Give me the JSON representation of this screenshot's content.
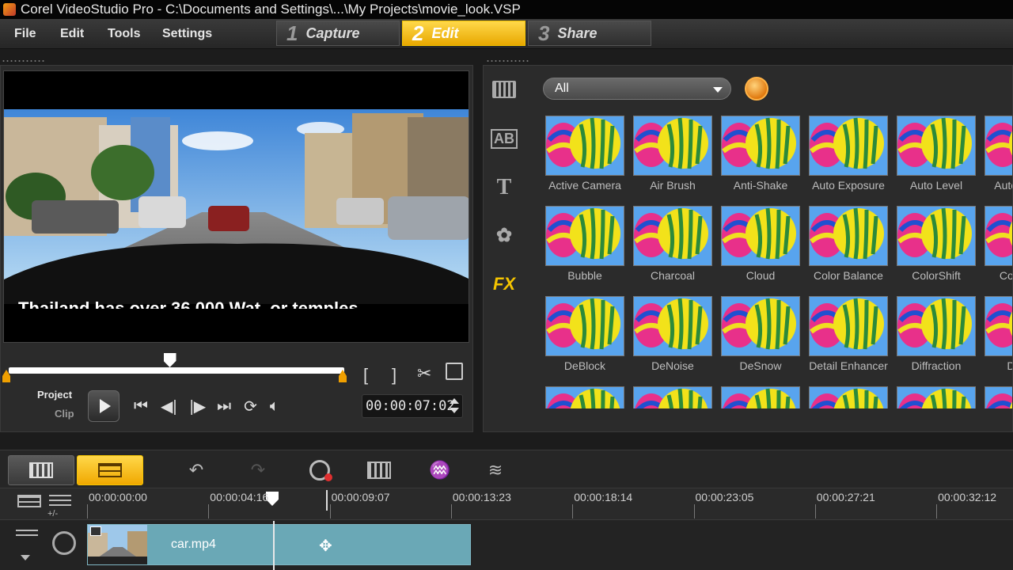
{
  "title": "Corel VideoStudio Pro - C:\\Documents and Settings\\...\\My Projects\\movie_look.VSP",
  "menu": {
    "file": "File",
    "edit": "Edit",
    "tools": "Tools",
    "settings": "Settings"
  },
  "steps": [
    {
      "num": "1",
      "label": "Capture"
    },
    {
      "num": "2",
      "label": "Edit"
    },
    {
      "num": "3",
      "label": "Share"
    }
  ],
  "preview": {
    "overlay_text": "Thailand has over 36,000 Wat, or temples",
    "project_label": "Project",
    "clip_label": "Clip",
    "timecode": "00:00:07:02",
    "scrub_position": 0.48
  },
  "library": {
    "filter": "All",
    "categories": [
      "media-icon",
      "transition-icon",
      "title-icon",
      "graphic-icon",
      "fx-icon"
    ],
    "fx_category_label": "FX",
    "effects": [
      [
        "Active Camera",
        "Air Brush",
        "Anti-Shake",
        "Auto Exposure",
        "Auto Level",
        "Auto Sketch"
      ],
      [
        "Bubble",
        "Charcoal",
        "Cloud",
        "Color Balance",
        "ColorShift",
        "Color Pen"
      ],
      [
        "DeBlock",
        "DeNoise",
        "DeSnow",
        "Detail Enhancer",
        "Diffraction",
        "Diffuse"
      ],
      [
        "",
        "",
        "",
        "",
        "",
        ""
      ]
    ]
  },
  "timeline": {
    "ruler": [
      "00:00:00:00",
      "00:00:04:16",
      "00:00:09:07",
      "00:00:13:23",
      "00:00:18:14",
      "00:00:23:05",
      "00:00:27:21",
      "00:00:32:12"
    ],
    "clip_name": "car.mp4",
    "zoom_label": "+/-"
  },
  "colors": {
    "accent": "#f5b800",
    "clip": "#6aa8b6"
  }
}
